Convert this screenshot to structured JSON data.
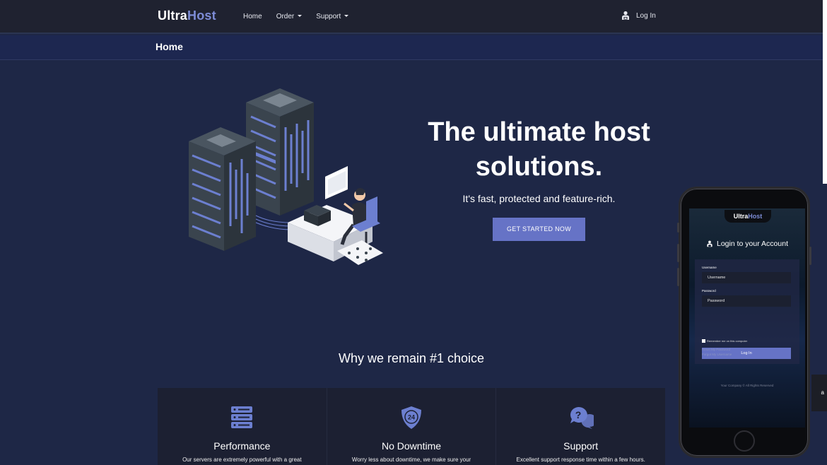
{
  "brand": {
    "part1": "Ultra",
    "part2": "Host"
  },
  "nav": {
    "home": "Home",
    "order": "Order",
    "support": "Support",
    "login": "Log In"
  },
  "breadcrumb": {
    "title": "Home"
  },
  "hero": {
    "title": "The ultimate host solutions.",
    "subtitle": "It's fast, protected and feature-rich.",
    "cta": "GET STARTED NOW"
  },
  "why": {
    "title": "Why we remain #1 choice",
    "features": [
      {
        "icon": "server-icon",
        "title": "Performance",
        "desc": "Our servers are extremely powerful with a great"
      },
      {
        "icon": "shield-24-icon",
        "title": "No Downtime",
        "desc": "Worry less about downtime, we make sure your"
      },
      {
        "icon": "question-chat-icon",
        "title": "Support",
        "desc": "Excellent support response time within a few hours."
      }
    ]
  },
  "phone": {
    "brand_part1": "Ultra",
    "brand_part2": "Host",
    "heading": "Login to your Account",
    "username_label": "Username",
    "username_placeholder": "Username",
    "password_label": "Password",
    "password_placeholder": "Password",
    "remember": "Remember me on this computer",
    "login_button": "Log In",
    "reset_password": "Reset My Password",
    "forgot_username": "Forgot My Username",
    "footer": "Your Company © All Rights Reserved"
  },
  "edge_text": "a",
  "colors": {
    "bg": "#1e2746",
    "navbar": "#1f2230",
    "accent": "#6673c6",
    "brand_accent": "#7d8cd6"
  }
}
